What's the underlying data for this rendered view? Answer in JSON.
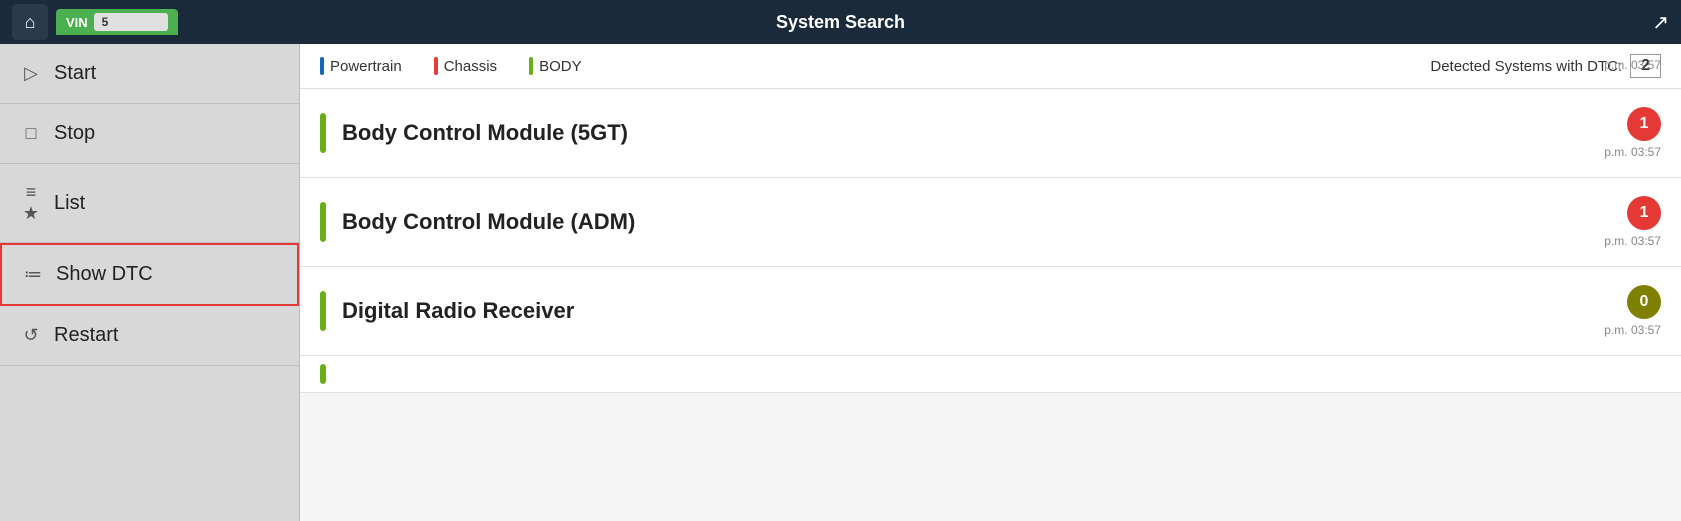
{
  "header": {
    "title": "System Search",
    "vin_label": "VIN",
    "vin_number": "5",
    "corner_icon": "↗"
  },
  "sidebar": {
    "items": [
      {
        "id": "start",
        "icon": "▷",
        "label": "Start",
        "active": false
      },
      {
        "id": "stop",
        "icon": "□",
        "label": "Stop",
        "active": false
      },
      {
        "id": "list",
        "icon": "≡ ★",
        "label": "List",
        "active": false
      },
      {
        "id": "show-dtc",
        "icon": "≔",
        "label": "Show DTC",
        "active": true
      },
      {
        "id": "restart",
        "icon": "↺",
        "label": "Restart",
        "active": false
      }
    ]
  },
  "sub_header": {
    "categories": [
      {
        "id": "powertrain",
        "label": "Powertrain",
        "color": "#1565c0"
      },
      {
        "id": "chassis",
        "label": "Chassis",
        "color": "#e53935"
      },
      {
        "id": "body",
        "label": "BODY",
        "color": "#6aaf1a"
      }
    ],
    "detected_label": "Detected Systems with DTC:",
    "detected_count": "2",
    "top_time": "p.m. 03:57"
  },
  "systems": [
    {
      "id": "bcm-5gt",
      "name": "Body Control Module (5GT)",
      "bar_color": "#6aaf1a",
      "dtc_count": "1",
      "dtc_color": "red",
      "time": "p.m. 03:57"
    },
    {
      "id": "bcm-adm",
      "name": "Body Control Module (ADM)",
      "bar_color": "#6aaf1a",
      "dtc_count": "1",
      "dtc_color": "red",
      "time": "p.m. 03:57"
    },
    {
      "id": "digital-radio",
      "name": "Digital Radio Receiver",
      "bar_color": "#6aaf1a",
      "dtc_count": "0",
      "dtc_color": "olive",
      "time": "p.m. 03:57"
    },
    {
      "id": "unknown",
      "name": "",
      "bar_color": "#6aaf1a",
      "dtc_count": "",
      "dtc_color": "",
      "time": ""
    }
  ]
}
